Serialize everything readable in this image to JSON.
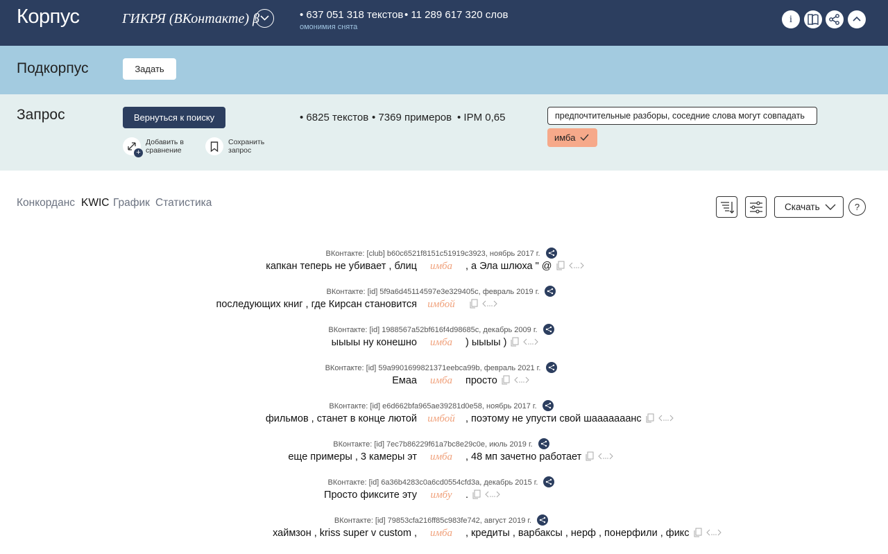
{
  "header": {
    "brand": "Корпус",
    "corpus_name": "ГИКРЯ (ВКонтакте) β",
    "stat_texts": "• 637 051 318 текстов",
    "stat_words": "• 11 289 617 320 слов",
    "homonymy_note": "омонимия снята",
    "buttons": [
      "info-icon",
      "book-icon",
      "share-icon",
      "collapse-icon"
    ]
  },
  "subcorpus": {
    "title": "Подкорпус",
    "set_button": "Задать"
  },
  "query": {
    "title": "Запрос",
    "back_button": "Вернуться к поиску",
    "stats": {
      "texts": "• 6825 текстов",
      "examples": "• 7369 примеров",
      "ipm": "• IPM 0,65"
    },
    "add_compare": "Добавить в сравнение",
    "save_query": "Сохранить запрос",
    "options": "предпочтительные разборы, соседние слова могут совпадать",
    "lemma": "имба"
  },
  "tabs": [
    "Конкорданс",
    "KWIC",
    "График",
    "Статистика"
  ],
  "active_tab": "KWIC",
  "tools": {
    "download_label": "Скачать",
    "help": "?"
  },
  "kwic": [
    {
      "meta": "ВКонтакте: [club] b60c6521f8151c51919c3923, ноябрь 2017 г.",
      "left": "капкан теперь не убивает , блиц",
      "kw": "имба",
      "right": ", а Эла шлюха \" @"
    },
    {
      "meta": "ВКонтакте: [id] 5f9a6d45114597e3e329405c, февраль 2019 г.",
      "left": "последующих книг , где Кирсан становится",
      "kw": "имбой",
      "right": ""
    },
    {
      "meta": "ВКонтакте: [id] 1988567a52bf616f4d98685c, декабрь 2009 г.",
      "left": "ыыыы ну конешно",
      "kw": "имба",
      "right": ") ыыыы )"
    },
    {
      "meta": "ВКонтакте: [id] 59a9901699821371eebca99b, февраль 2021 г.",
      "left": "Емаа",
      "kw": "имба",
      "right": "просто"
    },
    {
      "meta": "ВКонтакте: [id] e6d662bfa965ae39281d0e58, ноябрь 2017 г.",
      "left": "фильмов , станет в конце лютой",
      "kw": "имбой",
      "right": ", поэтому не упусти свой шааааааанс"
    },
    {
      "meta": "ВКонтакте: [id] 7ec7b86229f61a7bc8e29c0e, июль 2019 г.",
      "left": "еще примеры , 3 камеры эт",
      "kw": "имба",
      "right": ", 48 мп зачетно работает"
    },
    {
      "meta": "ВКонтакте: [id] 6a36b4283c0a6cd0554cfd3a, декабрь 2015 г.",
      "left": "Просто фиксите эту",
      "kw": "имбу",
      "right": "."
    },
    {
      "meta": "ВКонтакте: [id] 79853cfa216ff85c983fe742, август 2019 г.",
      "left": "хаймзон , kriss super v custom ,",
      "kw": "имба",
      "right": ", кредиты , варбаксы , нерф , понерфили , фикс"
    }
  ],
  "colors": {
    "header_bg": "#2c3e5f",
    "subcorpus_bg": "#a3cbe0",
    "query_bg": "#e4efef",
    "keyword": "#f0a07a",
    "lemma_tag": "#f6a98a"
  }
}
